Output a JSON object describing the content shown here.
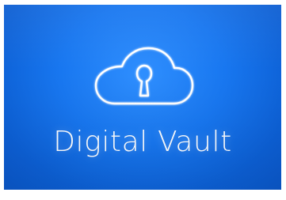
{
  "brand": {
    "title": "Digital Vault",
    "icon": "cloud-keyhole-icon",
    "background_color": "#1877f0",
    "foreground_color": "#ffffff"
  }
}
